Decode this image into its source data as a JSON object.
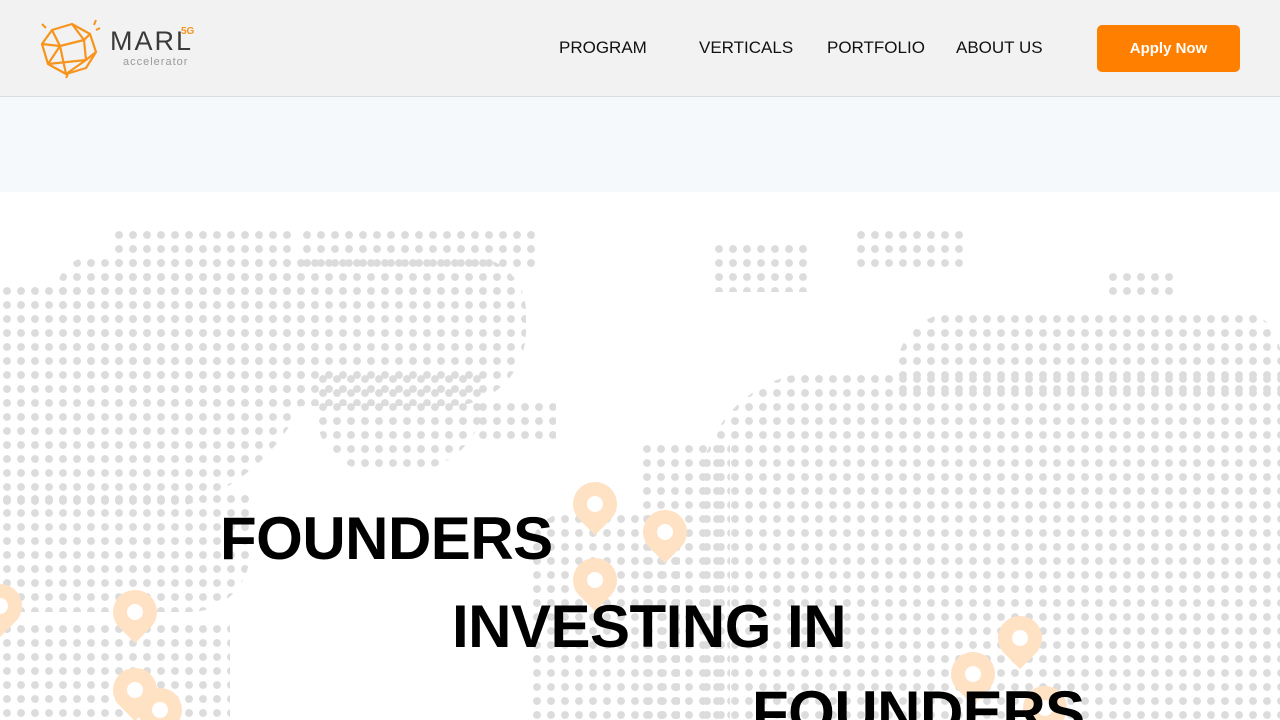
{
  "brand": {
    "name": "MARL",
    "superscript": "5G",
    "tagline": "accelerator",
    "accent": "#ff7f00"
  },
  "nav": {
    "items": [
      "PROGRAM",
      "VERTICALS",
      "PORTFOLIO",
      "ABOUT US"
    ],
    "cta": "Apply Now"
  },
  "hero": {
    "lines": [
      "FOUNDERS",
      "INVESTING IN",
      "FOUNDERS"
    ]
  }
}
